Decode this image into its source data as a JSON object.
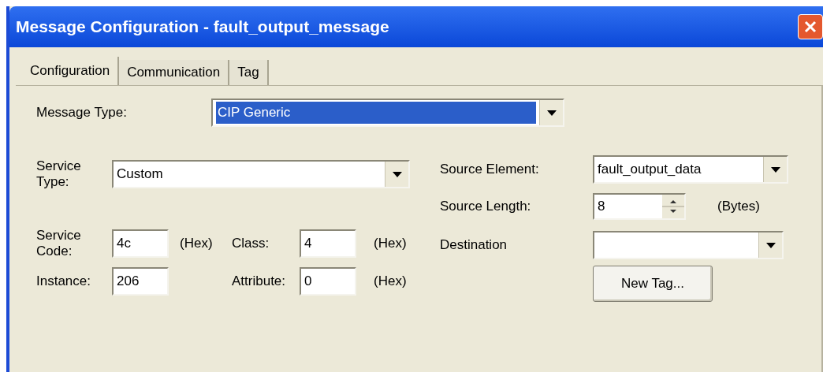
{
  "window": {
    "title": "Message Configuration - fault_output_message"
  },
  "tabs": [
    {
      "label": "Configuration",
      "selected": true
    },
    {
      "label": "Communication",
      "selected": false
    },
    {
      "label": "Tag",
      "selected": false
    }
  ],
  "message_type": {
    "label": "Message Type:",
    "value": "CIP Generic",
    "highlighted": true
  },
  "service_type": {
    "label": "Service Type:",
    "value": "Custom"
  },
  "service_code": {
    "label": "Service Code:",
    "value": "4c",
    "unit": "(Hex)"
  },
  "class": {
    "label": "Class:",
    "value": "4",
    "unit": "(Hex)"
  },
  "instance": {
    "label": "Instance:",
    "value": "206"
  },
  "attribute": {
    "label": "Attribute:",
    "value": "0",
    "unit": "(Hex)"
  },
  "source_element": {
    "label": "Source Element:",
    "value": "fault_output_data"
  },
  "source_length": {
    "label": "Source Length:",
    "value": "8",
    "unit": "(Bytes)"
  },
  "destination": {
    "label": "Destination"
  },
  "new_tag_button": "New Tag..."
}
